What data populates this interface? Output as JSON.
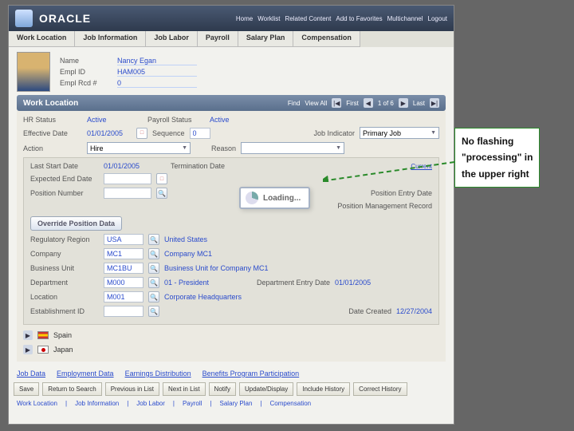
{
  "brand": "ORACLE",
  "header_links": [
    "Home",
    "Worklist",
    "Related Content",
    "Add to Favorites",
    "Multichannel",
    "Logout"
  ],
  "tabs": [
    "Work Location",
    "Job Information",
    "Job Labor",
    "Payroll",
    "Salary Plan",
    "Compensation"
  ],
  "emp": {
    "name_label": "Name",
    "name": "Nancy Egan",
    "id_label": "Empl ID",
    "id": "HAM005",
    "rec_label": "Empl Rcd #",
    "rec": "0"
  },
  "section": {
    "title": "Work Location",
    "find": "Find",
    "viewall": "View All",
    "first": "First",
    "counter": "1 of 6",
    "last": "Last"
  },
  "wl": {
    "hr_status_label": "HR Status",
    "hr_status": "Active",
    "payroll_status_label": "Payroll Status",
    "payroll_status": "Active",
    "eff_date_label": "Effective Date",
    "eff_date": "01/01/2005",
    "seq_label": "Sequence",
    "seq": "0",
    "job_ind_label": "Job Indicator",
    "job_ind": "Primary Job",
    "action_label": "Action",
    "action": "Hire",
    "reason_label": "Reason",
    "reason": ""
  },
  "sub": {
    "last_start_label": "Last Start Date",
    "last_start": "01/01/2005",
    "term_label": "Termination Date",
    "current": "Current",
    "exp_end_label": "Expected End Date",
    "pos_label": "Position Number",
    "pos_entry_label": "Position Entry Date",
    "pos_mgmt": "Position Management Record",
    "override_btn": "Override Position Data",
    "reg_label": "Regulatory Region",
    "reg": "USA",
    "reg_desc": "United States",
    "co_label": "Company",
    "co": "MC1",
    "co_desc": "Company MC1",
    "bu_label": "Business Unit",
    "bu": "MC1BU",
    "bu_desc": "Business Unit for Company MC1",
    "dept_label": "Department",
    "dept": "M000",
    "dept_desc": "01 - President",
    "dept_entry_label": "Department Entry Date",
    "dept_entry": "01/01/2005",
    "loc_label": "Location",
    "loc": "M001",
    "loc_desc": "Corporate Headquarters",
    "estab_label": "Establishment ID",
    "created_label": "Date Created",
    "created": "12/27/2004"
  },
  "flags": {
    "es": "Spain",
    "jp": "Japan"
  },
  "bottom_links": [
    "Job Data",
    "Employment Data",
    "Earnings Distribution",
    "Benefits Program Participation"
  ],
  "action_buttons": [
    "Save",
    "Return to Search",
    "Previous in List",
    "Next in List",
    "Notify",
    "Update/Display",
    "Include History",
    "Correct History"
  ],
  "bottom_tabs": [
    "Work Location",
    "Job Information",
    "Job Labor",
    "Payroll",
    "Salary Plan",
    "Compensation"
  ],
  "loading_text": "Loading...",
  "callout_line1": "No flashing",
  "callout_line2": "\"processing\" in",
  "callout_line3": "the upper right"
}
